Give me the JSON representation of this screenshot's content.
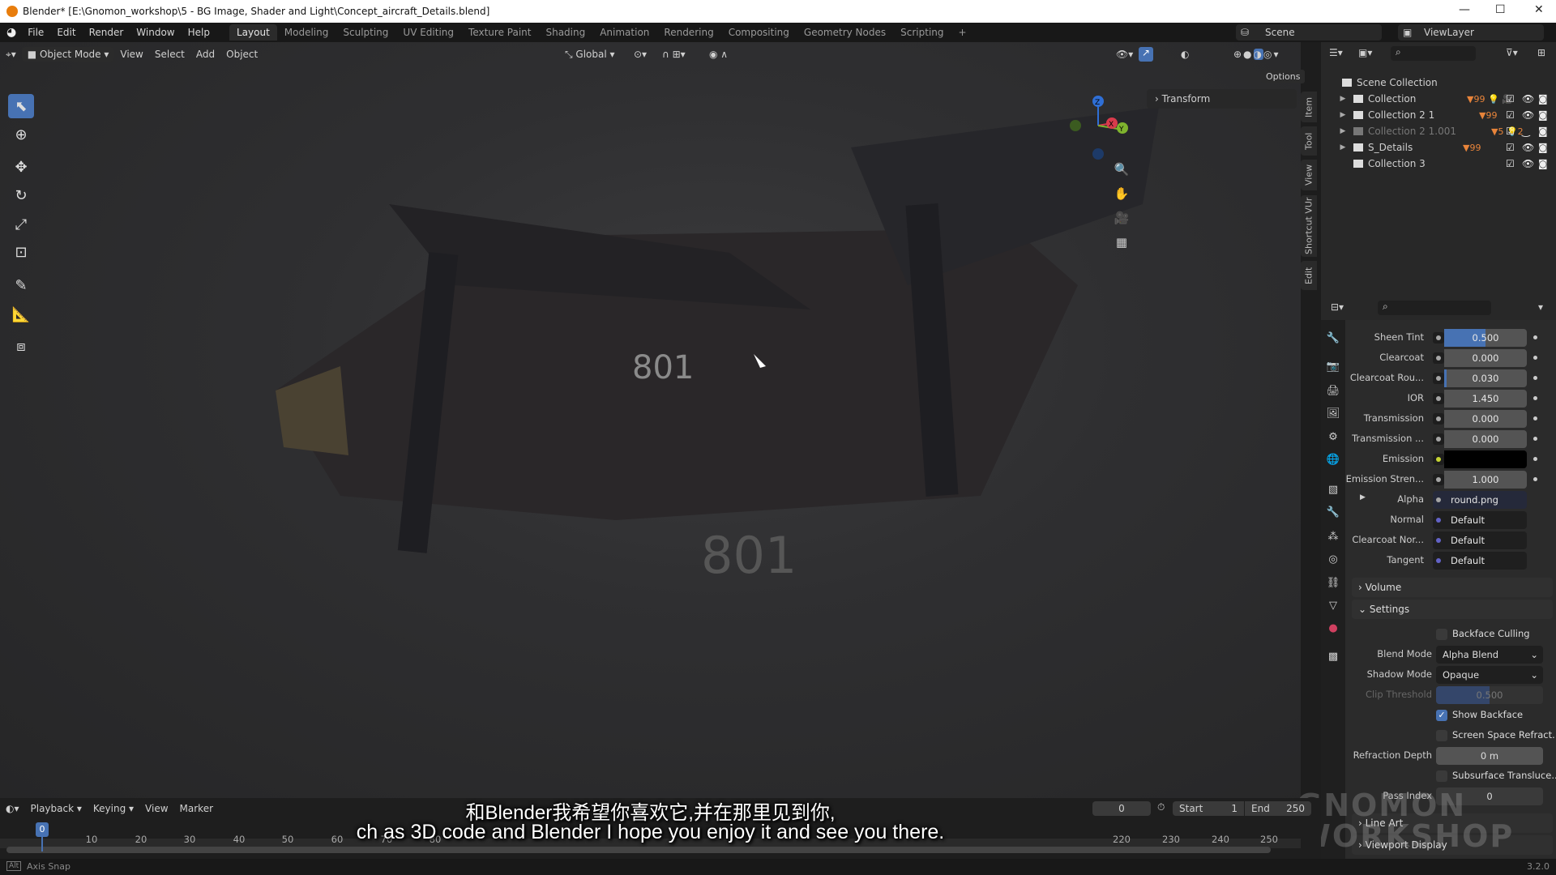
{
  "window": {
    "title": "Blender* [E:\\Gnomon_workshop\\5 - BG Image, Shader and Light\\Concept_aircraft_Details.blend]",
    "minimize": "—",
    "maximize": "☐",
    "close": "✕"
  },
  "menubar": {
    "items": [
      "File",
      "Edit",
      "Render",
      "Window",
      "Help"
    ],
    "workspaces": [
      "Layout",
      "Modeling",
      "Sculpting",
      "UV Editing",
      "Texture Paint",
      "Shading",
      "Animation",
      "Rendering",
      "Compositing",
      "Geometry Nodes",
      "Scripting"
    ],
    "active_workspace": "Layout",
    "add_tab": "+",
    "scene": "Scene",
    "view_layer": "ViewLayer"
  },
  "viewport_header": {
    "mode": "Object Mode",
    "menus": [
      "View",
      "Select",
      "Add",
      "Object"
    ],
    "orientation": "Global",
    "options": "Options"
  },
  "viewport": {
    "sidebar_panel": "Transform",
    "sidebar_tabs": [
      "Item",
      "Tool",
      "View",
      "Shortcut VUr",
      "Edit"
    ],
    "aircraft_marking": "801",
    "gizmo_axes": [
      "X",
      "Y",
      "Z"
    ]
  },
  "outliner": {
    "root": "Scene Collection",
    "items": [
      {
        "name": "Collection",
        "badges": "▼99 💡 🎥",
        "disabled": false
      },
      {
        "name": "Collection 2 1",
        "badges": "▼99",
        "disabled": false
      },
      {
        "name": "Collection 2 1.001",
        "badges": "▼5 💡2",
        "disabled": true
      },
      {
        "name": "S_Details",
        "badges": "▼99",
        "disabled": false
      },
      {
        "name": "Collection 3",
        "badges": "",
        "disabled": false
      }
    ]
  },
  "properties": {
    "rows": [
      {
        "label": "Sheen Tint",
        "value": "0.500",
        "fill": 0.5
      },
      {
        "label": "Clearcoat",
        "value": "0.000",
        "fill": 0
      },
      {
        "label": "Clearcoat Rou...",
        "value": "0.030",
        "fill": 0.03
      },
      {
        "label": "IOR",
        "value": "1.450",
        "fill": 0
      },
      {
        "label": "Transmission",
        "value": "0.000",
        "fill": 0
      },
      {
        "label": "Transmission ...",
        "value": "0.000",
        "fill": 0
      },
      {
        "label": "Emission",
        "value": "",
        "color": "#000000"
      },
      {
        "label": "Emission Stren...",
        "value": "1.000",
        "fill": 0
      },
      {
        "label": "Alpha",
        "value": "round.png"
      },
      {
        "label": "Normal",
        "value": "Default"
      },
      {
        "label": "Clearcoat Nor...",
        "value": "Default"
      },
      {
        "label": "Tangent",
        "value": "Default"
      }
    ],
    "volume": "Volume",
    "settings": "Settings",
    "backface_culling": "Backface Culling",
    "blend_mode_label": "Blend Mode",
    "blend_mode": "Alpha Blend",
    "shadow_mode_label": "Shadow Mode",
    "shadow_mode": "Opaque",
    "clip_label": "Clip Threshold",
    "clip_value": "0.500",
    "show_backface": "Show Backface",
    "ssr": "Screen Space Refract...",
    "refraction_label": "Refraction Depth",
    "refraction_value": "0 m",
    "subsurface": "Subsurface Transluce...",
    "pass_label": "Pass Index",
    "pass_value": "0",
    "line_art": "Line Art",
    "viewport_display": "Viewport Display"
  },
  "timeline": {
    "menus": [
      "Playback",
      "Keying",
      "View",
      "Marker"
    ],
    "current_frame": "0",
    "start_label": "Start",
    "start": "1",
    "end_label": "End",
    "end": "250",
    "ticks": [
      "10",
      "20",
      "30",
      "40",
      "50",
      "60",
      "70",
      "80",
      "220",
      "230",
      "240",
      "250"
    ],
    "playhead": "0"
  },
  "subtitles": {
    "zh": "和Blender我希望你喜欢它,并在那里见到你,",
    "en": "ch as 3D code and Blender  I hope you enjoy it and see you there."
  },
  "statusbar": {
    "key": "Alt",
    "hint": "Axis Snap",
    "version": "3.2.0"
  },
  "watermark": "THE GNOMON WORKSHOP",
  "colors": {
    "accent": "#4772b3",
    "emission_socket": "#c7d634",
    "vector_socket": "#6363c7"
  }
}
